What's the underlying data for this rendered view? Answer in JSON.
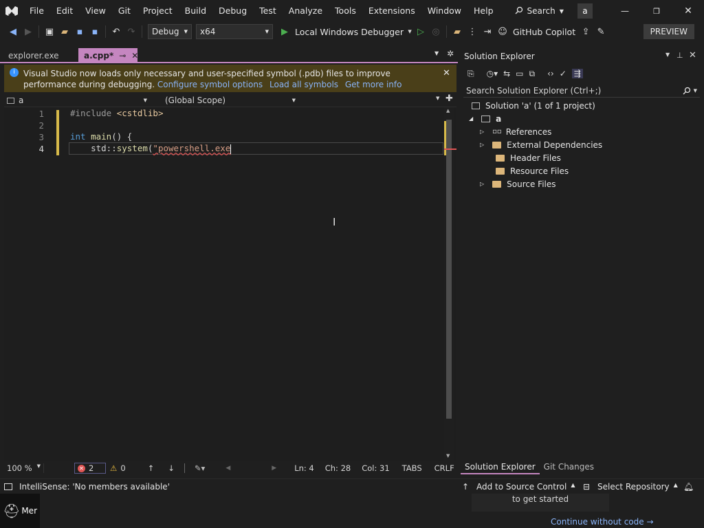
{
  "menu": [
    "File",
    "Edit",
    "View",
    "Git",
    "Project",
    "Build",
    "Debug",
    "Test",
    "Analyze",
    "Tools",
    "Extensions",
    "Window",
    "Help"
  ],
  "search_label": "Search",
  "account_initial": "a",
  "toolbar": {
    "config": "Debug",
    "platform": "x64",
    "debugger": "Local Windows Debugger",
    "copilot": "GitHub Copilot",
    "preview": "PREVIEW"
  },
  "tabs": [
    {
      "label": "explorer.exe"
    },
    {
      "label": "a.cpp*"
    }
  ],
  "infobar": {
    "message": "Visual Studio now loads only necessary and user-specified symbol (.pdb) files to improve performance during debugging.",
    "links": [
      "Configure symbol options",
      "Load all symbols",
      "Get more info"
    ]
  },
  "navbar": {
    "project": "a",
    "scope": "(Global Scope)"
  },
  "code_lines": [
    {
      "num": "1",
      "text": "#include <cstdlib>"
    },
    {
      "num": "2",
      "text": ""
    },
    {
      "num": "3",
      "text": "int main() {"
    },
    {
      "num": "4",
      "text": "    std::system(\"powershell.exe"
    }
  ],
  "editor_status": {
    "zoom": "100 %",
    "errors": "2",
    "warnings": "0",
    "line": "Ln: 4",
    "char": "Ch: 28",
    "col": "Col: 31",
    "tabs": "TABS",
    "eol": "CRLF"
  },
  "solution_explorer": {
    "title": "Solution Explorer",
    "search_placeholder": "Search Solution Explorer (Ctrl+;)",
    "solution": "Solution 'a' (1 of 1 project)",
    "project": "a",
    "items": [
      "References",
      "External Dependencies",
      "Header Files",
      "Resource Files",
      "Source Files"
    ],
    "bottom_tabs": [
      "Solution Explorer",
      "Git Changes"
    ]
  },
  "statusbar": {
    "intellisense": "IntelliSense: 'No members available'",
    "source_control": "Add to Source Control",
    "repository": "Select Repository"
  },
  "taskbar": {
    "app_label": "Mer",
    "get_started": "to get started",
    "continue": "Continue without code →"
  },
  "colors": {
    "accent": "#c586c0",
    "infobar": "#4a3f19",
    "link": "#8ab4f8",
    "error": "#e05555"
  }
}
